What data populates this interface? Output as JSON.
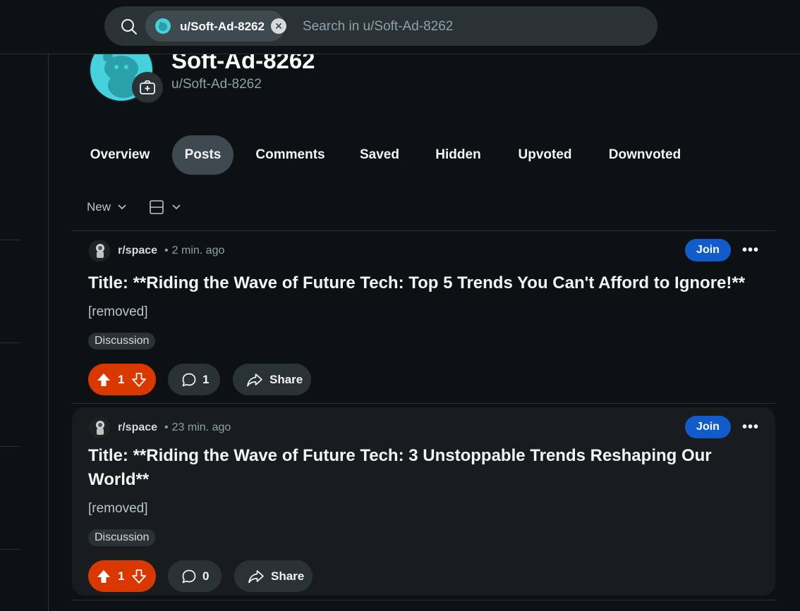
{
  "search": {
    "scope_chip_label": "u/Soft-Ad-8262",
    "placeholder": "Search in u/Soft-Ad-8262"
  },
  "profile": {
    "display_name": "Soft-Ad-8262",
    "username": "u/Soft-Ad-8262"
  },
  "tabs": [
    {
      "label": "Overview",
      "active": false
    },
    {
      "label": "Posts",
      "active": true
    },
    {
      "label": "Comments",
      "active": false
    },
    {
      "label": "Saved",
      "active": false
    },
    {
      "label": "Hidden",
      "active": false
    },
    {
      "label": "Upvoted",
      "active": false
    },
    {
      "label": "Downvoted",
      "active": false
    }
  ],
  "sort": {
    "label": "New"
  },
  "posts": [
    {
      "subreddit": "r/space",
      "separator": "•",
      "time": "2 min. ago",
      "join_label": "Join",
      "more_label": "•••",
      "title": "Title: **Riding the Wave of Future Tech: Top 5 Trends You Can't Afford to Ignore!**",
      "body": "[removed]",
      "flair": "Discussion",
      "votes": "1",
      "comments": "1",
      "share_label": "Share"
    },
    {
      "subreddit": "r/space",
      "separator": "•",
      "time": "23 min. ago",
      "join_label": "Join",
      "more_label": "•••",
      "title": "Title: **Riding the Wave of Future Tech: 3 Unstoppable Trends Reshaping Our World**",
      "body": "[removed]",
      "flair": "Discussion",
      "votes": "1",
      "comments": "0",
      "share_label": "Share"
    }
  ],
  "colors": {
    "background": "#0e1113",
    "upvote_active": "#d93900",
    "join_button": "#115bca",
    "pill_background": "#2a3236",
    "active_tab": "#3e4a50"
  }
}
